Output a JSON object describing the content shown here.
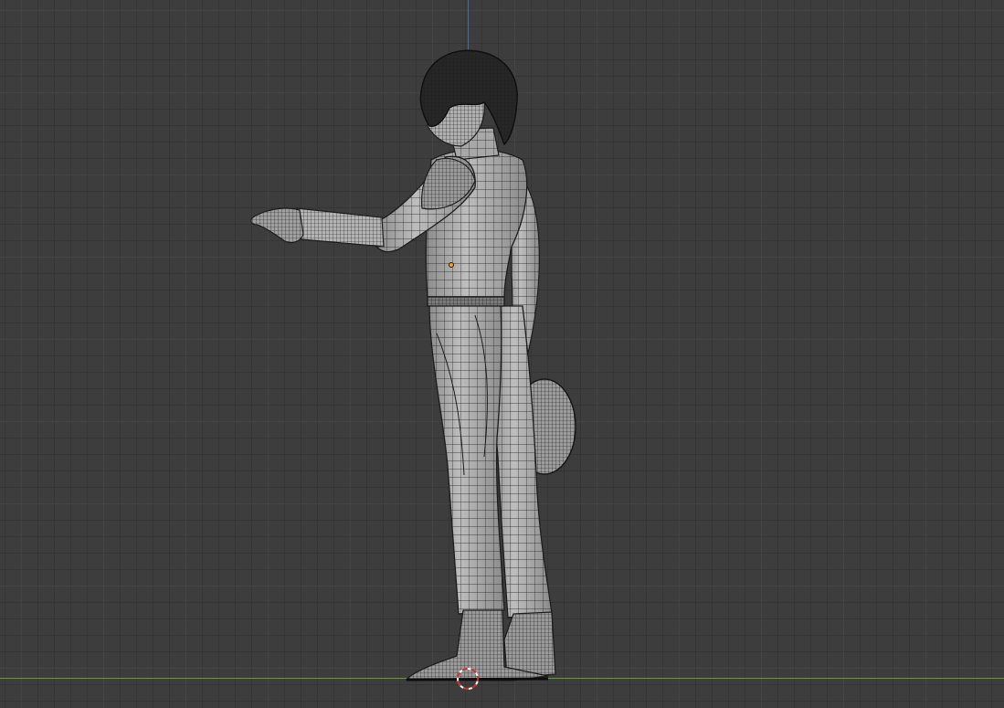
{
  "viewport": {
    "mode": "3d-viewport-wireframe",
    "colors": {
      "background": "#3d3d3d",
      "grid_major": "#464646",
      "axis_z": "#3e6fa8",
      "axis_y": "#6c9a2a",
      "mesh_fill": "#a9a9a9",
      "wire": "#1c1c1c",
      "origin": "#ff9f1a"
    }
  },
  "scene": {
    "object": "character-mesh",
    "origin_icon": "object-origin-dot",
    "cursor_icon": "3d-cursor-icon"
  }
}
